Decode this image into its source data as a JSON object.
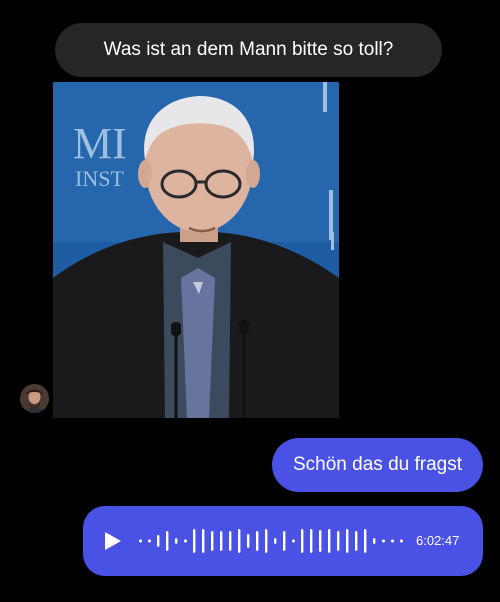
{
  "messages": {
    "received_text": "Was ist an dem Mann bitte so toll?",
    "photo_sign_line1": "MI",
    "photo_sign_line2": "INST",
    "sent_text": "Schön das du fragst",
    "voice_duration": "6:02:47"
  },
  "icons": {
    "play": "play-icon",
    "avatar": "avatar"
  },
  "colors": {
    "background": "#000000",
    "received_bubble": "#262628",
    "sent_bubble": "#4a52e6",
    "text": "#ffffff"
  }
}
